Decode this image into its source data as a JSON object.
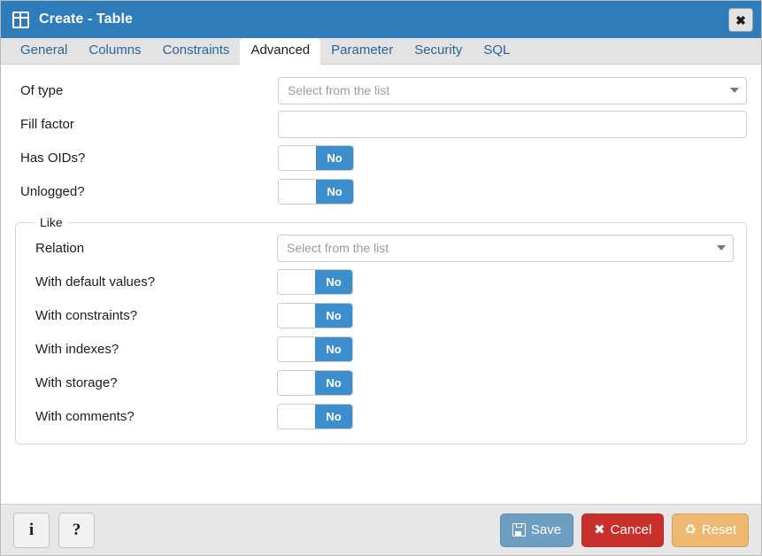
{
  "window": {
    "title": "Create - Table",
    "icon": "table-grid-icon",
    "close_label": "✖"
  },
  "tabs": [
    {
      "label": "General",
      "active": false
    },
    {
      "label": "Columns",
      "active": false
    },
    {
      "label": "Constraints",
      "active": false
    },
    {
      "label": "Advanced",
      "active": true
    },
    {
      "label": "Parameter",
      "active": false
    },
    {
      "label": "Security",
      "active": false
    },
    {
      "label": "SQL",
      "active": false
    }
  ],
  "form": {
    "of_type": {
      "label": "Of type",
      "placeholder": "Select from the list",
      "value": ""
    },
    "fill_factor": {
      "label": "Fill factor",
      "placeholder": "",
      "value": ""
    },
    "has_oids": {
      "label": "Has OIDs?",
      "value": "No"
    },
    "unlogged": {
      "label": "Unlogged?",
      "value": "No"
    }
  },
  "like": {
    "legend": "Like",
    "relation": {
      "label": "Relation",
      "placeholder": "Select from the list",
      "value": ""
    },
    "toggles": [
      {
        "label": "With default values?",
        "value": "No"
      },
      {
        "label": "With constraints?",
        "value": "No"
      },
      {
        "label": "With indexes?",
        "value": "No"
      },
      {
        "label": "With storage?",
        "value": "No"
      },
      {
        "label": "With comments?",
        "value": "No"
      }
    ]
  },
  "footer": {
    "info_label": "i",
    "help_label": "?",
    "save_label": "Save",
    "cancel_label": "Cancel",
    "cancel_glyph": "✖",
    "reset_label": "Reset",
    "reset_glyph": "♻"
  },
  "colors": {
    "titlebar": "#2f7cbb",
    "tabstrip": "#e3e3e3",
    "toggle_on": "#3d8ecc",
    "save": "#6e9ec1",
    "cancel": "#c9302c",
    "reset": "#eeb870",
    "link": "#2a6496"
  }
}
